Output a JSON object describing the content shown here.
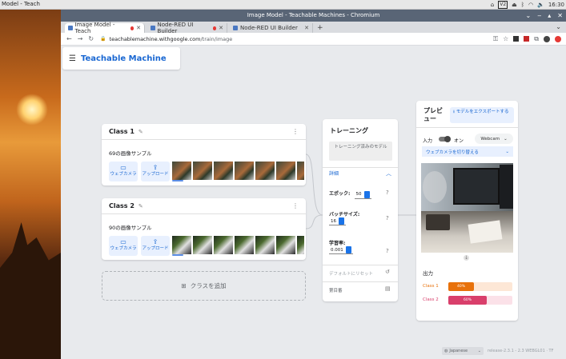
{
  "taskbar": {
    "window_title": "Model - Teach",
    "clock": "16:30",
    "v2_label": "V2"
  },
  "browser": {
    "title": "Image Model - Teachable Machines - Chromium",
    "tabs": [
      {
        "label": "Image Model - Teach",
        "recording": true
      },
      {
        "label": "Node-RED UI Builder",
        "recording": true
      },
      {
        "label": "Node-RED UI Builder",
        "recording": false
      }
    ],
    "new_tab": "+",
    "url_host": "teachablemachine.withgoogle.com",
    "url_path": "/train/image"
  },
  "app": {
    "brand": "Teachable Machine"
  },
  "classes": [
    {
      "name": "Class 1",
      "sample_count": "69の画像サンプル",
      "webcam_label": "ウェブカメラ",
      "upload_label": "アップロード"
    },
    {
      "name": "Class 2",
      "sample_count": "90の画像サンプル",
      "webcam_label": "ウェブカメラ",
      "upload_label": "アップロード"
    }
  ],
  "add_class_label": "クラスを追加",
  "training": {
    "title": "トレーニング",
    "train_button": "トレーニング済みのモデル",
    "advanced_label": "詳細",
    "epochs_label": "エポック:",
    "epochs_value": "50",
    "batch_label": "バッチサイズ:",
    "batch_value": "16",
    "lr_label": "学習率:",
    "lr_value": "0.001",
    "reset_label": "デフォルトにリセット",
    "docs_label": "第目番"
  },
  "preview": {
    "title": "プレビュー",
    "export_label": "モデルをエクスポートする",
    "input_label": "入力",
    "on_label": "オン",
    "source_value": "Webcam",
    "switch_camera_label": "ウェブカメラを切り替える",
    "output_label": "出力",
    "results": [
      {
        "name": "Class 1",
        "percent": 40,
        "display": "40%",
        "color": "#e8710a"
      },
      {
        "name": "Class 2",
        "percent": 60,
        "display": "60%",
        "color": "#d93f6b"
      }
    ]
  },
  "footer": {
    "language": "Japanese",
    "version": "release-2.3.1 - 2.3 WEBGL01 · TF"
  }
}
